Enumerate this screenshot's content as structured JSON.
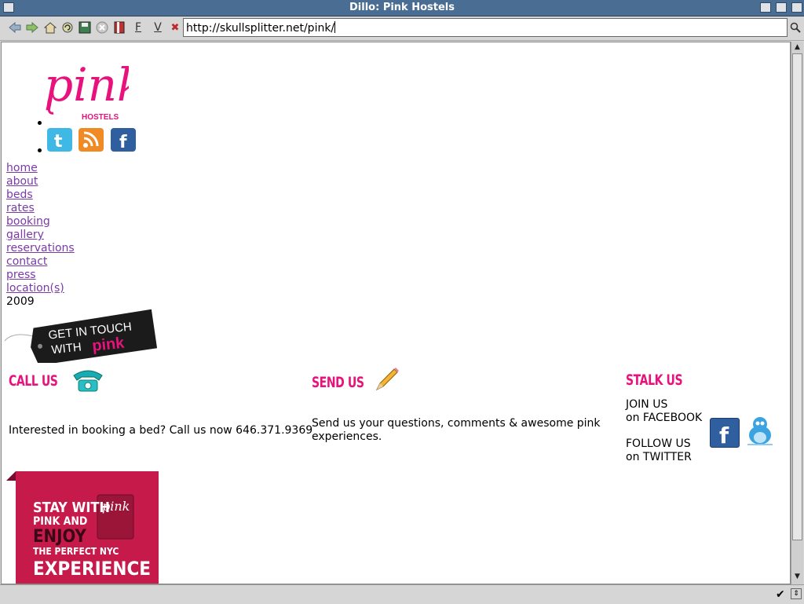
{
  "window": {
    "title": "Dillo: Pink Hostels"
  },
  "toolbar": {
    "back_icon": "back-arrow-icon",
    "forward_icon": "forward-arrow-icon",
    "home_icon": "home-icon",
    "reload_icon": "reload-icon",
    "save_icon": "save-icon",
    "stop_icon": "stop-icon",
    "bookmarks_icon": "bookmarks-icon",
    "f_label": "F",
    "v_label": "V",
    "clear_icon": "clear-url-icon",
    "url": "http://skullsplitter.net/pink/",
    "search_icon": "search-icon"
  },
  "page": {
    "logo_text": "pink",
    "logo_sub": "HOSTELS",
    "social_top": [
      {
        "name": "twitter-icon",
        "color": "#3fb8e6"
      },
      {
        "name": "rss-icon",
        "color": "#f08a24"
      },
      {
        "name": "facebook-icon",
        "color": "#2f5f9e"
      }
    ],
    "nav": [
      "home",
      "about",
      "beds",
      "rates",
      "booking",
      "gallery",
      "reservations",
      "contact",
      "press",
      "location(s)"
    ],
    "year": "2009",
    "touch_line1": "GET IN TOUCH",
    "touch_line2": "WITH",
    "touch_pink": "pink",
    "call": {
      "heading": "CALL US",
      "text": "Interested in booking a bed? Call us now 646.371.9369"
    },
    "send": {
      "heading": "SEND US",
      "text_line1": "Send us your questions, comments & awesome pink",
      "text_line2": "experiences."
    },
    "stalk": {
      "heading": "STALK US",
      "join_line1": "JOIN US",
      "join_line2": "on FACEBOOK",
      "follow_line1": "FOLLOW US",
      "follow_line2": "on TWITTER"
    },
    "banner": {
      "line1": "STAY WITH",
      "line2": "PINK AND",
      "line3": "ENJOY",
      "line4": "THE PERFECT NYC",
      "line5": "EXPERIENCE",
      "badge": "pink"
    }
  },
  "colors": {
    "brand_pink": "#e8127c",
    "link": "#7a3aa8",
    "titlebar": "#4a6d93"
  }
}
